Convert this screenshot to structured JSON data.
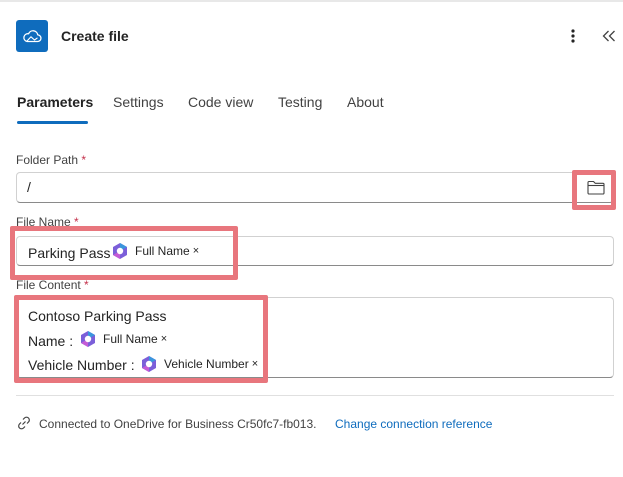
{
  "header": {
    "title": "Create file",
    "icon": "onedrive-cloud-icon",
    "accent": "#0f6cbd"
  },
  "tabs": [
    {
      "label": "Parameters",
      "active": true
    },
    {
      "label": "Settings",
      "active": false
    },
    {
      "label": "Code view",
      "active": false
    },
    {
      "label": "Testing",
      "active": false
    },
    {
      "label": "About",
      "active": false
    }
  ],
  "fields": {
    "folder_path": {
      "label": "Folder Path",
      "required_mark": "*",
      "value": "/"
    },
    "file_name": {
      "label": "File Name",
      "required_mark": "*",
      "text": "Parking Pass",
      "token": "Full Name",
      "token_remove": "×"
    },
    "file_content": {
      "label": "File Content",
      "required_mark": "*",
      "line1": "Contoso Parking Pass",
      "line2_label": "Name :",
      "line2_token": "Full Name",
      "line3_label": "Vehicle Number :",
      "line3_token": "Vehicle Number",
      "token_remove": "×"
    }
  },
  "connection": {
    "text": "Connected to OneDrive for Business Cr50fc7-fb013.",
    "link": "Change connection reference"
  },
  "colors": {
    "highlight": "#e8767d",
    "link": "#0f6cbd",
    "required": "#c4314b"
  }
}
